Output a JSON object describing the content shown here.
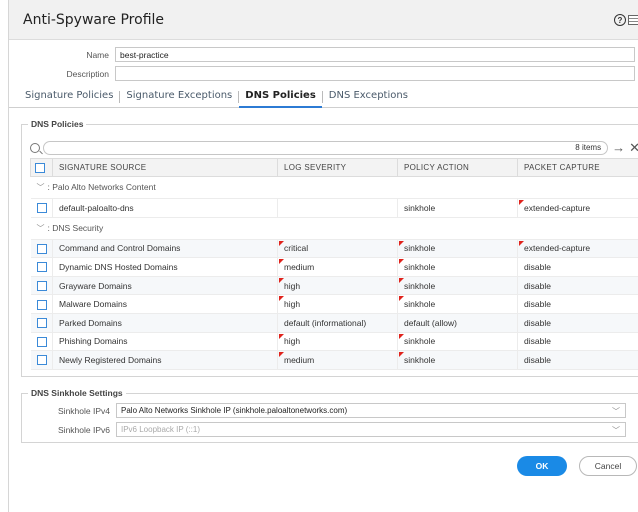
{
  "dialog": {
    "title": "Anti-Spyware Profile"
  },
  "form": {
    "name_label": "Name",
    "name_value": "best-practice",
    "description_label": "Description",
    "description_value": ""
  },
  "tabs": [
    {
      "label": "Signature Policies"
    },
    {
      "label": "Signature Exceptions"
    },
    {
      "label": "DNS Policies",
      "active": true
    },
    {
      "label": "DNS Exceptions"
    }
  ],
  "dns_policies": {
    "legend": "DNS Policies",
    "search_value": "",
    "item_count": "8 items",
    "columns": [
      "SIGNATURE SOURCE",
      "LOG SEVERITY",
      "POLICY ACTION",
      "PACKET CAPTURE"
    ],
    "groups": [
      {
        "label": ": Palo Alto Networks Content",
        "rows": [
          {
            "source": "default-paloalto-dns",
            "severity": "",
            "action": "sinkhole",
            "capture": "extended-capture",
            "sev_flag": false,
            "act_flag": false,
            "cap_flag": true
          }
        ]
      },
      {
        "label": ": DNS Security",
        "rows": [
          {
            "source": "Command and Control Domains",
            "severity": "critical",
            "action": "sinkhole",
            "capture": "extended-capture",
            "sev_flag": true,
            "act_flag": true,
            "cap_flag": true
          },
          {
            "source": "Dynamic DNS Hosted Domains",
            "severity": "medium",
            "action": "sinkhole",
            "capture": "disable",
            "sev_flag": true,
            "act_flag": true,
            "cap_flag": false
          },
          {
            "source": "Grayware Domains",
            "severity": "high",
            "action": "sinkhole",
            "capture": "disable",
            "sev_flag": true,
            "act_flag": true,
            "cap_flag": false
          },
          {
            "source": "Malware Domains",
            "severity": "high",
            "action": "sinkhole",
            "capture": "disable",
            "sev_flag": true,
            "act_flag": true,
            "cap_flag": false
          },
          {
            "source": "Parked Domains",
            "severity": "default (informational)",
            "action": "default (allow)",
            "capture": "disable",
            "sev_flag": false,
            "act_flag": false,
            "cap_flag": false
          },
          {
            "source": "Phishing Domains",
            "severity": "high",
            "action": "sinkhole",
            "capture": "disable",
            "sev_flag": true,
            "act_flag": true,
            "cap_flag": false
          },
          {
            "source": "Newly Registered Domains",
            "severity": "medium",
            "action": "sinkhole",
            "capture": "disable",
            "sev_flag": true,
            "act_flag": true,
            "cap_flag": false
          }
        ]
      }
    ]
  },
  "sinkhole": {
    "legend": "DNS Sinkhole Settings",
    "ipv4_label": "Sinkhole IPv4",
    "ipv4_value": "Palo Alto Networks Sinkhole IP (sinkhole.paloaltonetworks.com)",
    "ipv6_label": "Sinkhole IPv6",
    "ipv6_value": "IPv6 Loopback IP (::1)"
  },
  "buttons": {
    "ok": "OK",
    "cancel": "Cancel"
  },
  "colors": {
    "accent": "#1a8ae6",
    "flag": "#e0231c",
    "active_tab": "#2c7bd4"
  }
}
